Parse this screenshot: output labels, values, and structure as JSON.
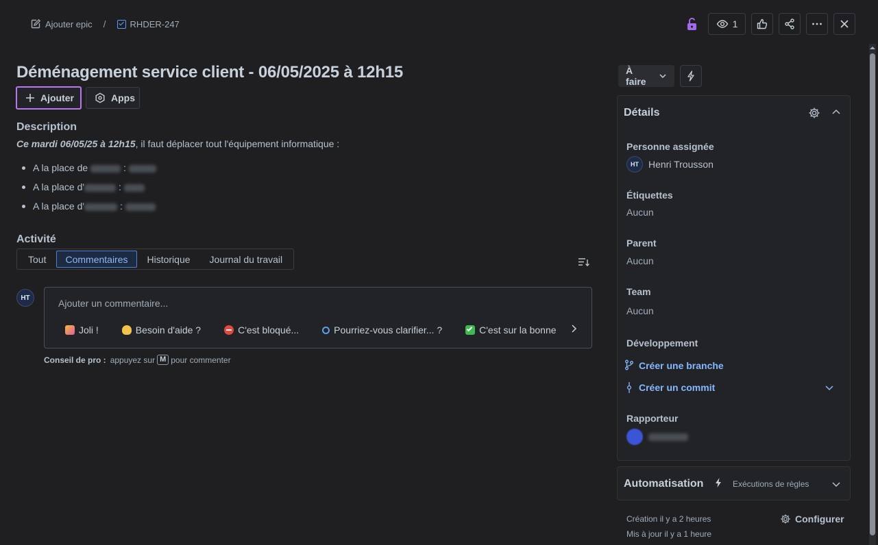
{
  "breadcrumb": {
    "parent_label": "Ajouter epic",
    "issue_key": "RHDER-247"
  },
  "toolbar": {
    "watch_count": "1"
  },
  "issue": {
    "title": "Déménagement service client - 06/05/2025 à 12h15"
  },
  "actions": {
    "add_label": "Ajouter",
    "apps_label": "Apps"
  },
  "description": {
    "heading": "Description",
    "intro_bold": "Ce mardi 06/05/25 à 12h15",
    "intro_rest": ", il faut déplacer tout l'équipement informatique :",
    "items": [
      {
        "prefix": "A la place de",
        "sep": ":"
      },
      {
        "prefix": "A la place d'",
        "sep": ":"
      },
      {
        "prefix": "A la place d'",
        "sep": ":"
      }
    ]
  },
  "activity": {
    "heading": "Activité",
    "tabs": [
      "Tout",
      "Commentaires",
      "Historique",
      "Journal du travail"
    ],
    "active_tab": "Commentaires"
  },
  "comment": {
    "avatar_initials": "HT",
    "placeholder": "Ajouter un commentaire...",
    "quick_replies": [
      "Joli !",
      "Besoin d'aide ?",
      "C'est bloqué...",
      "Pourriez-vous clarifier... ?",
      "C'est sur la bonne"
    ],
    "tip_label": "Conseil de pro :",
    "tip_text_before": "appuyez sur",
    "tip_key": "M",
    "tip_text_after": "pour commenter"
  },
  "status": {
    "label": "À faire"
  },
  "details": {
    "heading": "Détails",
    "assignee_label": "Personne assignée",
    "assignee_initials": "HT",
    "assignee_name": "Henri Trousson",
    "labels_label": "Étiquettes",
    "labels_value": "Aucun",
    "parent_label": "Parent",
    "parent_value": "Aucun",
    "team_label": "Team",
    "team_value": "Aucun",
    "dev_label": "Développement",
    "create_branch": "Créer une branche",
    "create_commit": "Créer un commit",
    "reporter_label": "Rapporteur"
  },
  "automation": {
    "heading": "Automatisation",
    "rule_runs": "Exécutions de règles"
  },
  "footer": {
    "created": "Création il y a 2 heures",
    "updated": "Mis à jour il y a 1 heure",
    "configure": "Configurer"
  },
  "colors": {
    "background": "#1f1f21",
    "accent_link": "#85b8ff",
    "focus_ring": "#b57ce8",
    "unlock_icon": "#9f6bea"
  }
}
